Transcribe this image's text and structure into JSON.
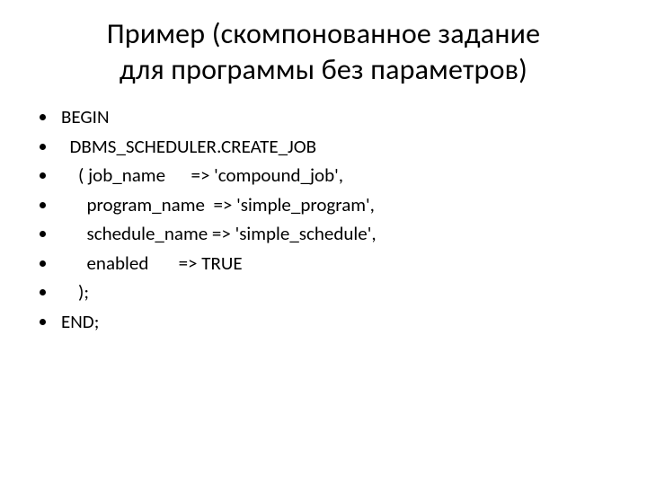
{
  "title_line1": "Пример (скомпонованное задание",
  "title_line2": "для программы без параметров)",
  "lines": [
    "BEGIN",
    "  DBMS_SCHEDULER.CREATE_JOB",
    "    ( job_name      => 'compound_job',",
    "      program_name  => 'simple_program',",
    "      schedule_name => 'simple_schedule',",
    "      enabled       => TRUE",
    "    );",
    "END;"
  ]
}
